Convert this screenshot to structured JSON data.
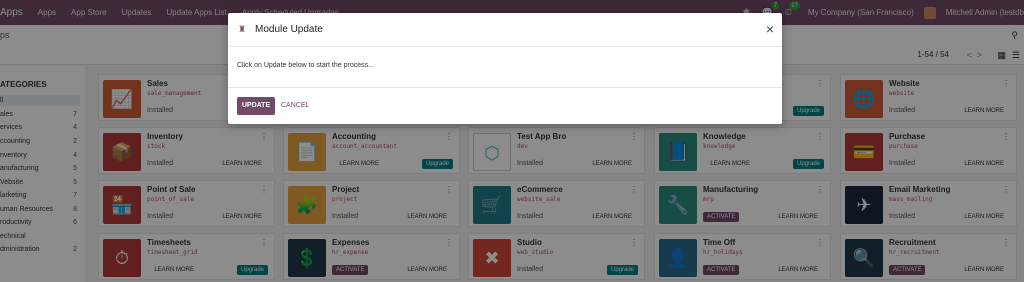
{
  "navbar": {
    "brand": "Apps",
    "items": [
      "Apps",
      "App Store",
      "Updates",
      "Update Apps List",
      "Apply Scheduled Upgrades"
    ],
    "chat_badge": "7",
    "activity_badge": "17",
    "company": "My Company (San Francisco)",
    "user": "Mitchell Admin (testdb"
  },
  "control": {
    "breadcrumb": "ps",
    "pager": "1-54 / 54",
    "prev": "<",
    "next": ">"
  },
  "sidebar": {
    "title": "ATEGORIES",
    "items": [
      {
        "label": "ll",
        "count": ""
      },
      {
        "label": "ales",
        "count": "7"
      },
      {
        "label": "ervices",
        "count": "4"
      },
      {
        "label": "ccounting",
        "count": "2"
      },
      {
        "label": "nventory",
        "count": "4"
      },
      {
        "label": "anufacturing",
        "count": "5"
      },
      {
        "label": "Vebsite",
        "count": "5"
      },
      {
        "label": "larketing",
        "count": "7"
      },
      {
        "label": "uman Resources",
        "count": "8"
      },
      {
        "label": "roductivity",
        "count": "6"
      },
      {
        "label": "echnical",
        "count": ""
      },
      {
        "label": "dministration",
        "count": "2"
      }
    ]
  },
  "cards": [
    {
      "name": "Sales",
      "tech": "sale_management",
      "status": "Installed",
      "learn": "",
      "upgrade": "",
      "activate": "",
      "color": "#d05b35",
      "icon": "📈"
    },
    {
      "name": "",
      "tech": "",
      "status": "",
      "learn": "",
      "upgrade": "Upgrade",
      "activate": "",
      "color": "#ffffff",
      "icon": ""
    },
    {
      "name": "Website",
      "tech": "website",
      "status": "Installed",
      "learn": "LEARN MORE",
      "upgrade": "",
      "activate": "",
      "color": "#d05b35",
      "icon": "🌐"
    },
    {
      "name": "Inventory",
      "tech": "stock",
      "status": "Installed",
      "learn": "LEARN MORE",
      "upgrade": "",
      "activate": "",
      "color": "#b33a3a",
      "icon": "📦"
    },
    {
      "name": "Accounting",
      "tech": "account_accountant",
      "status": "",
      "learn": "LEARN MORE",
      "upgrade": "Upgrade",
      "activate": "",
      "color": "#e8a33c",
      "icon": "📄"
    },
    {
      "name": "Test App Bro",
      "tech": "dev",
      "status": "Installed",
      "learn": "LEARN MORE",
      "upgrade": "",
      "activate": "",
      "color": "#ffffff",
      "icon": "⬡"
    },
    {
      "name": "Knowledge",
      "tech": "knowledge",
      "status": "",
      "learn": "LEARN MORE",
      "upgrade": "Upgrade",
      "activate": "",
      "color": "#2a8c7e",
      "icon": "📘"
    },
    {
      "name": "Purchase",
      "tech": "purchase",
      "status": "Installed",
      "learn": "LEARN MORE",
      "upgrade": "",
      "activate": "",
      "color": "#b33a3a",
      "icon": "💳"
    },
    {
      "name": "Point of Sale",
      "tech": "point_of_sale",
      "status": "Installed",
      "learn": "LEARN MORE",
      "upgrade": "",
      "activate": "",
      "color": "#b33a3a",
      "icon": "🏪"
    },
    {
      "name": "Project",
      "tech": "project",
      "status": "Installed",
      "learn": "LEARN MORE",
      "upgrade": "",
      "activate": "",
      "color": "#e8a33c",
      "icon": "🧩"
    },
    {
      "name": "eCommerce",
      "tech": "website_sale",
      "status": "Installed",
      "learn": "LEARN MORE",
      "upgrade": "",
      "activate": "",
      "color": "#1f7a8c",
      "icon": "🛒"
    },
    {
      "name": "Manufacturing",
      "tech": "mrp",
      "status": "",
      "learn": "LEARN MORE",
      "upgrade": "",
      "activate": "ACTIVATE",
      "color": "#2a8c7e",
      "icon": "🔧"
    },
    {
      "name": "Email Marketing",
      "tech": "mass_mailing",
      "status": "Installed",
      "learn": "LEARN MORE",
      "upgrade": "",
      "activate": "",
      "color": "#1a2a3a",
      "icon": "✈"
    },
    {
      "name": "Timesheets",
      "tech": "timesheet_grid",
      "status": "",
      "learn": "LEARN MORE",
      "upgrade": "Upgrade",
      "activate": "",
      "color": "#b33a3a",
      "icon": "⏱"
    },
    {
      "name": "Expenses",
      "tech": "hr_expense",
      "status": "",
      "learn": "LEARN MORE",
      "upgrade": "",
      "activate": "ACTIVATE",
      "color": "#1f3a4a",
      "icon": "💲"
    },
    {
      "name": "Studio",
      "tech": "web_studio",
      "status": "Installed",
      "learn": "",
      "upgrade": "Upgrade",
      "activate": "",
      "color": "#d04a3a",
      "icon": "✖"
    },
    {
      "name": "Time Off",
      "tech": "hr_holidays",
      "status": "",
      "learn": "LEARN MORE",
      "upgrade": "",
      "activate": "ACTIVATE",
      "color": "#2a6c8c",
      "icon": "👤"
    },
    {
      "name": "Recruitment",
      "tech": "hr_recruitment",
      "status": "",
      "learn": "LEARN MORE",
      "upgrade": "",
      "activate": "ACTIVATE",
      "color": "#1f3a4a",
      "icon": "🔍"
    }
  ],
  "modal": {
    "title": "Module Update",
    "body": "Click on Update below to start the process...",
    "primary": "UPDATE",
    "secondary": "CANCEL",
    "close": "×"
  },
  "colors": {
    "brand": "#714B67",
    "upgrade": "#017e84"
  }
}
